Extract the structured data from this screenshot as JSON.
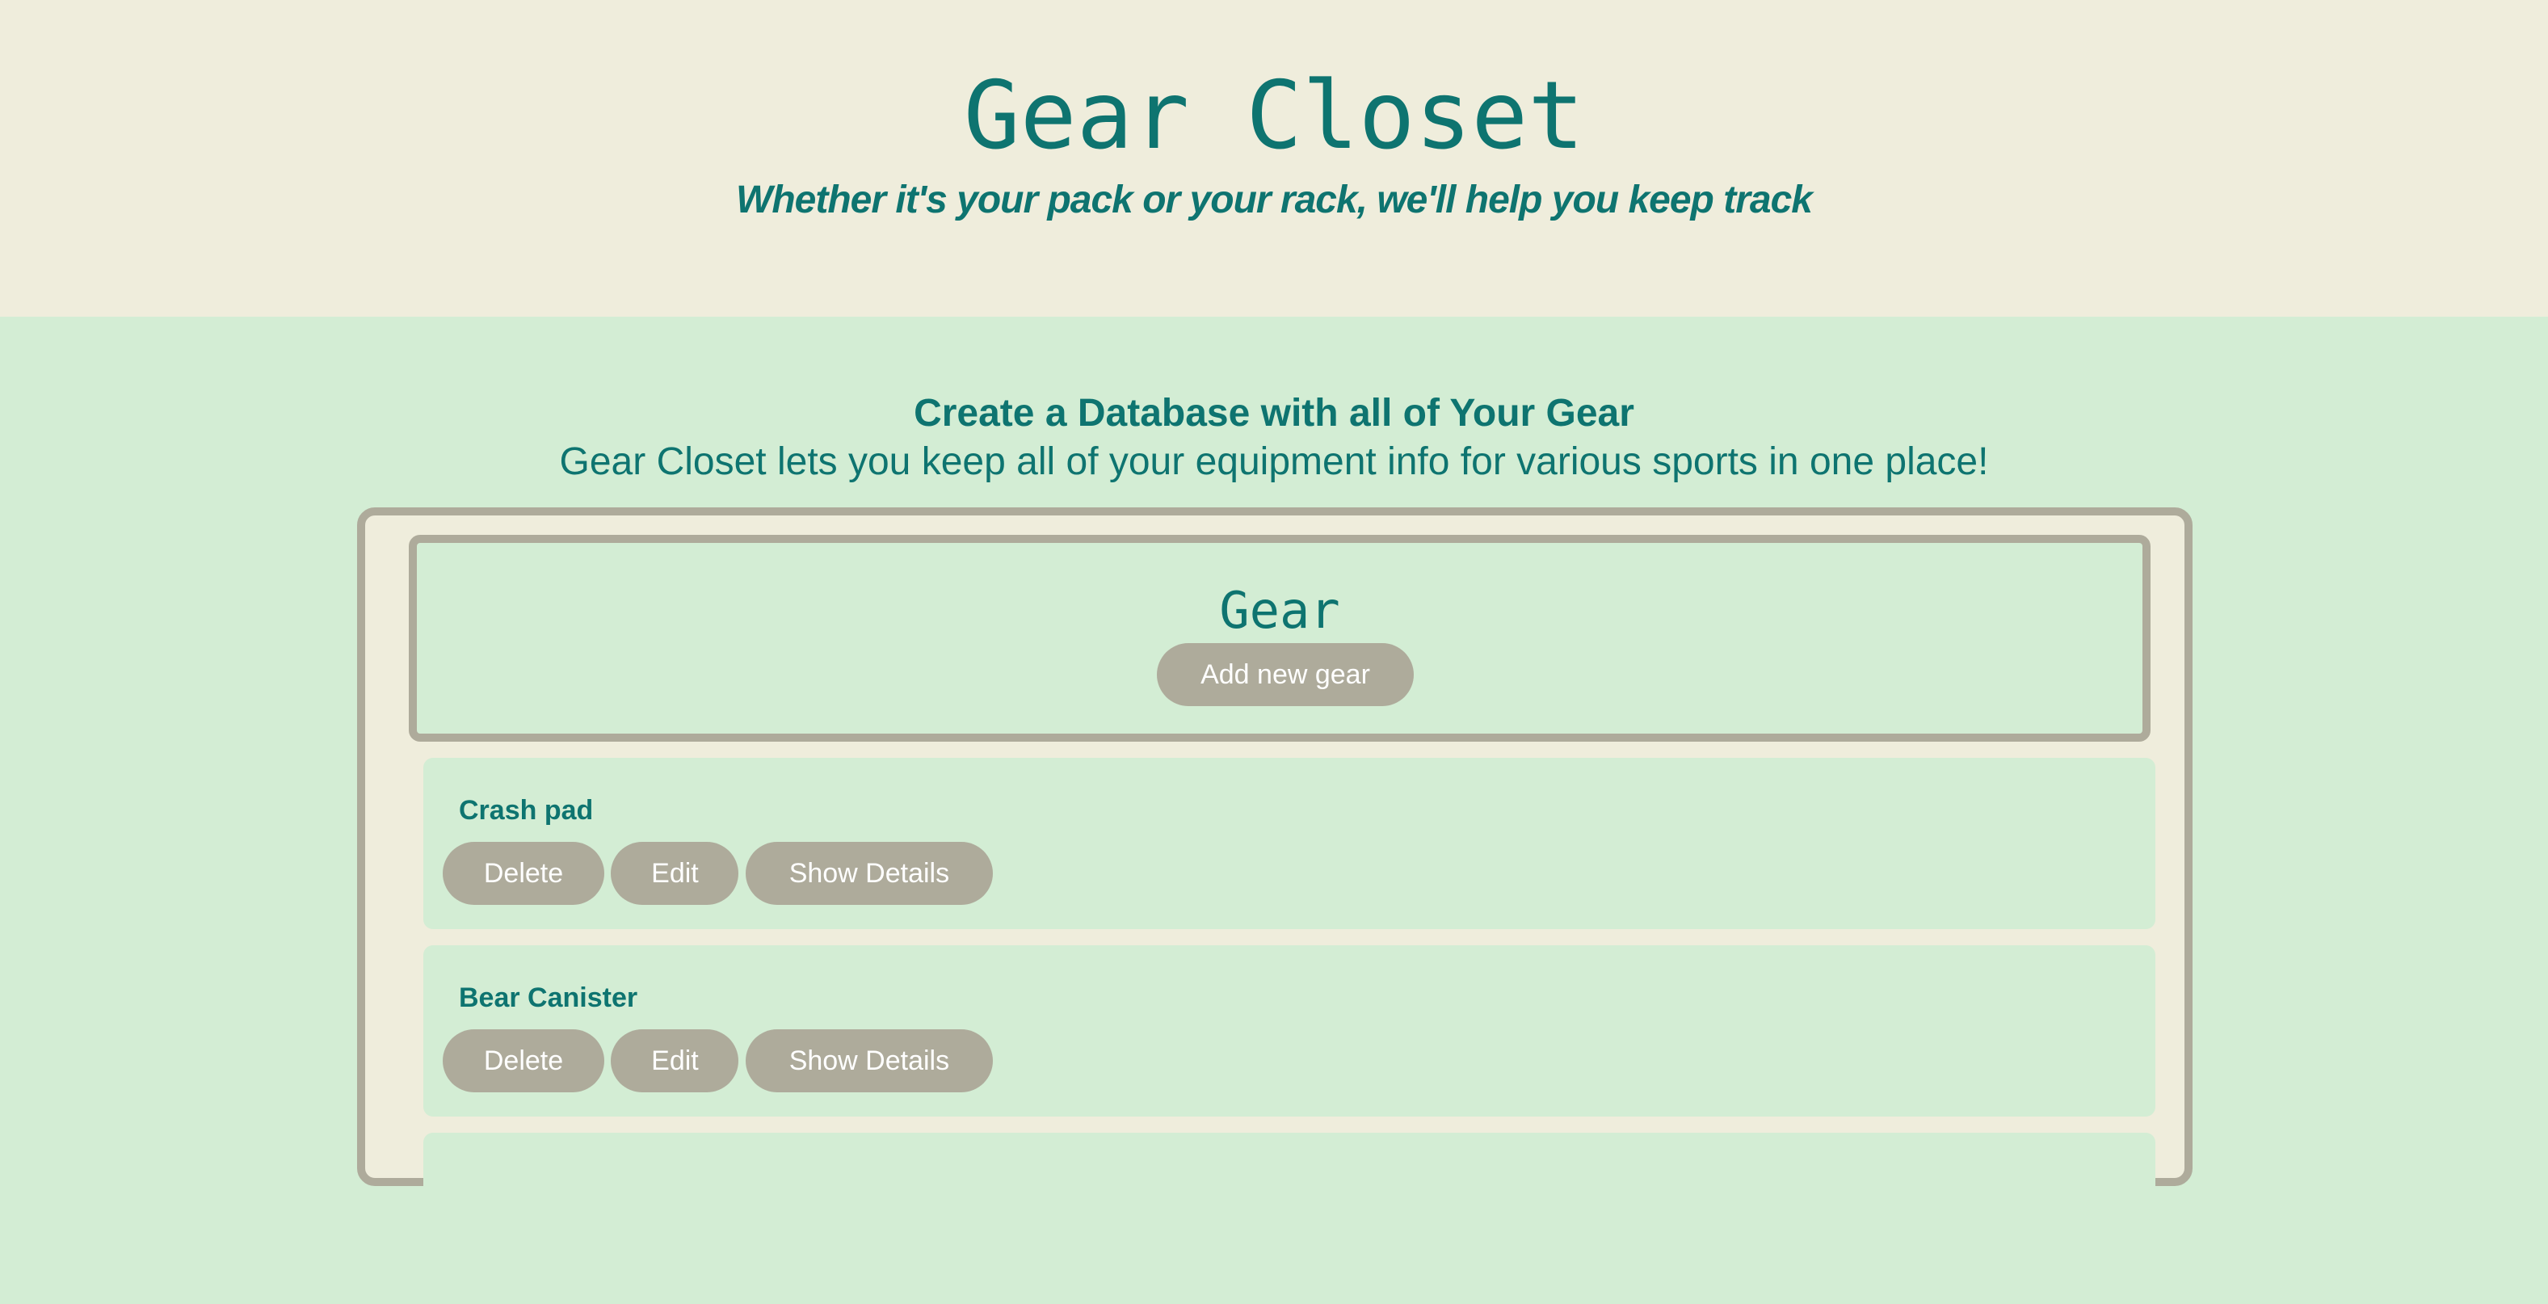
{
  "header": {
    "title": "Gear Closet",
    "tagline": "Whether it's your pack or your rack, we'll help you keep track"
  },
  "intro": {
    "heading": "Create a Database with all of Your Gear",
    "text": "Gear Closet lets you keep all of your equipment info for various sports in one place!"
  },
  "gear": {
    "title": "Gear",
    "add_label": "Add new gear",
    "items": [
      {
        "name": "Crash pad"
      },
      {
        "name": "Bear Canister"
      },
      {
        "name": ""
      }
    ],
    "delete_label": "Delete",
    "edit_label": "Edit",
    "details_label": "Show Details"
  },
  "colors": {
    "header_bg": "#efeddc",
    "main_bg": "#d3edd4",
    "accent_text": "#0e7470",
    "button_bg": "#aeab9b",
    "button_text": "#ffffff"
  }
}
